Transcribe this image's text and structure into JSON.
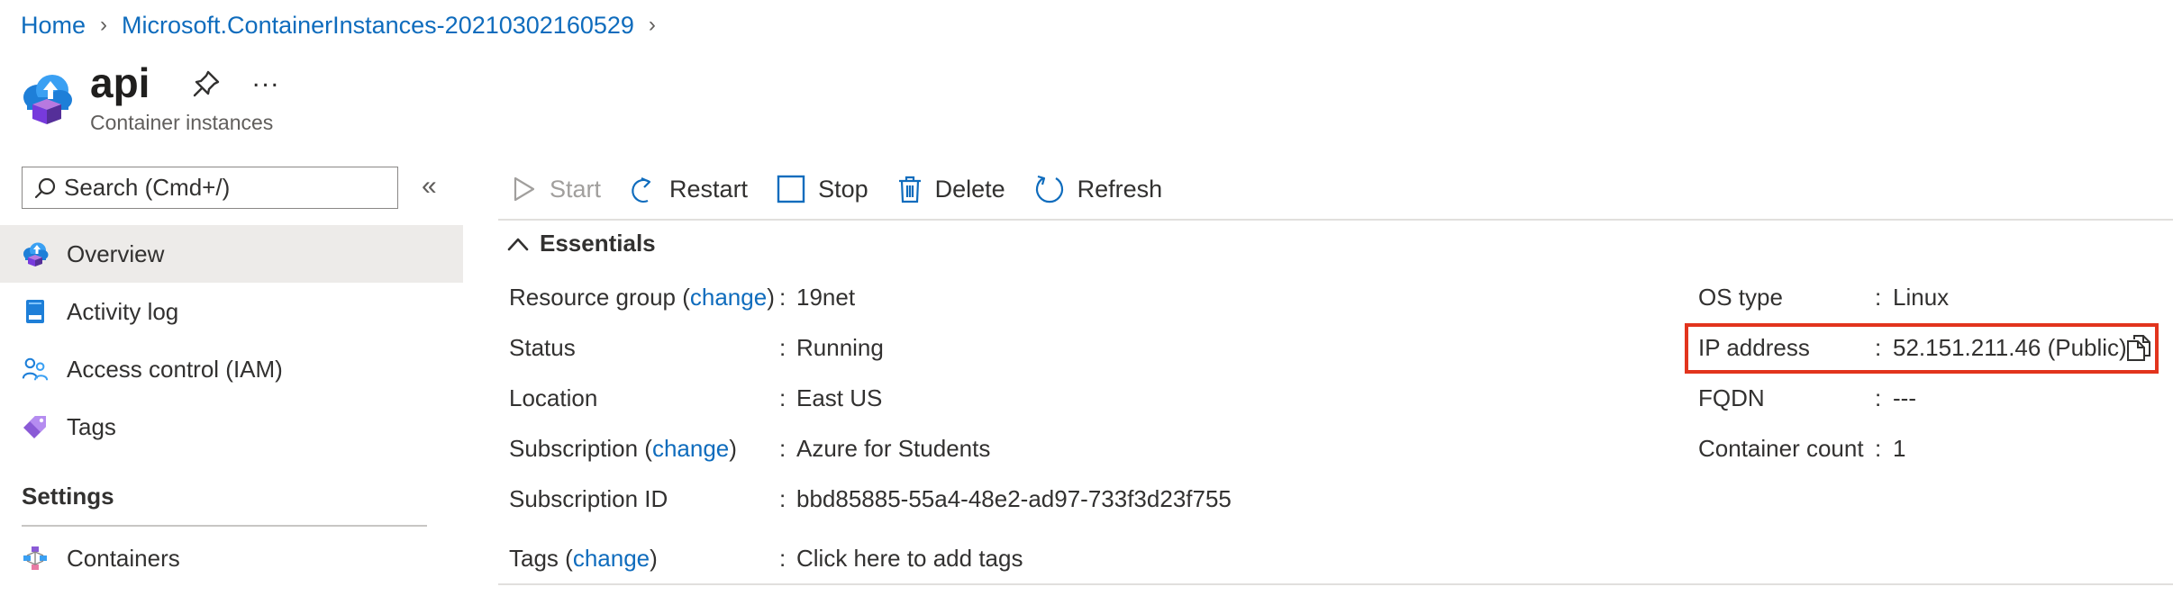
{
  "breadcrumb": {
    "home": "Home",
    "resource_group": "Microsoft.ContainerInstances-20210302160529"
  },
  "header": {
    "title": "api",
    "subtitle": "Container instances",
    "more": "..."
  },
  "search": {
    "placeholder": "Search (Cmd+/)",
    "collapse": "«"
  },
  "sidebar": {
    "items": [
      {
        "label": "Overview",
        "icon": "cloud-container-icon"
      },
      {
        "label": "Activity log",
        "icon": "activity-log-icon"
      },
      {
        "label": "Access control (IAM)",
        "icon": "people-icon"
      },
      {
        "label": "Tags",
        "icon": "tag-icon"
      }
    ],
    "settings_heading": "Settings",
    "settings_items": [
      {
        "label": "Containers",
        "icon": "containers-icon"
      }
    ]
  },
  "toolbar": {
    "start": "Start",
    "restart": "Restart",
    "stop": "Stop",
    "delete": "Delete",
    "refresh": "Refresh"
  },
  "essentials": {
    "heading": "Essentials",
    "left": {
      "resource_group": {
        "label": "Resource group",
        "change": "change",
        "value": "19net"
      },
      "status": {
        "label": "Status",
        "value": "Running"
      },
      "location": {
        "label": "Location",
        "value": "East US"
      },
      "subscription": {
        "label": "Subscription",
        "change": "change",
        "value": "Azure for Students"
      },
      "subscription_id": {
        "label": "Subscription ID",
        "value": "bbd85885-55a4-48e2-ad97-733f3d23f755"
      },
      "tags": {
        "label": "Tags",
        "change": "change",
        "value": "Click here to add tags"
      }
    },
    "right": {
      "os_type": {
        "label": "OS type",
        "value": "Linux"
      },
      "ip_address": {
        "label": "IP address",
        "value": "52.151.211.46 (Public)"
      },
      "fqdn": {
        "label": "FQDN",
        "value": "---"
      },
      "container_count": {
        "label": "Container count",
        "value": "1"
      }
    },
    "colon": ":"
  },
  "colors": {
    "accent": "#0f6cbd",
    "highlight": "#e2341d",
    "selected_bg": "#edebe9"
  }
}
